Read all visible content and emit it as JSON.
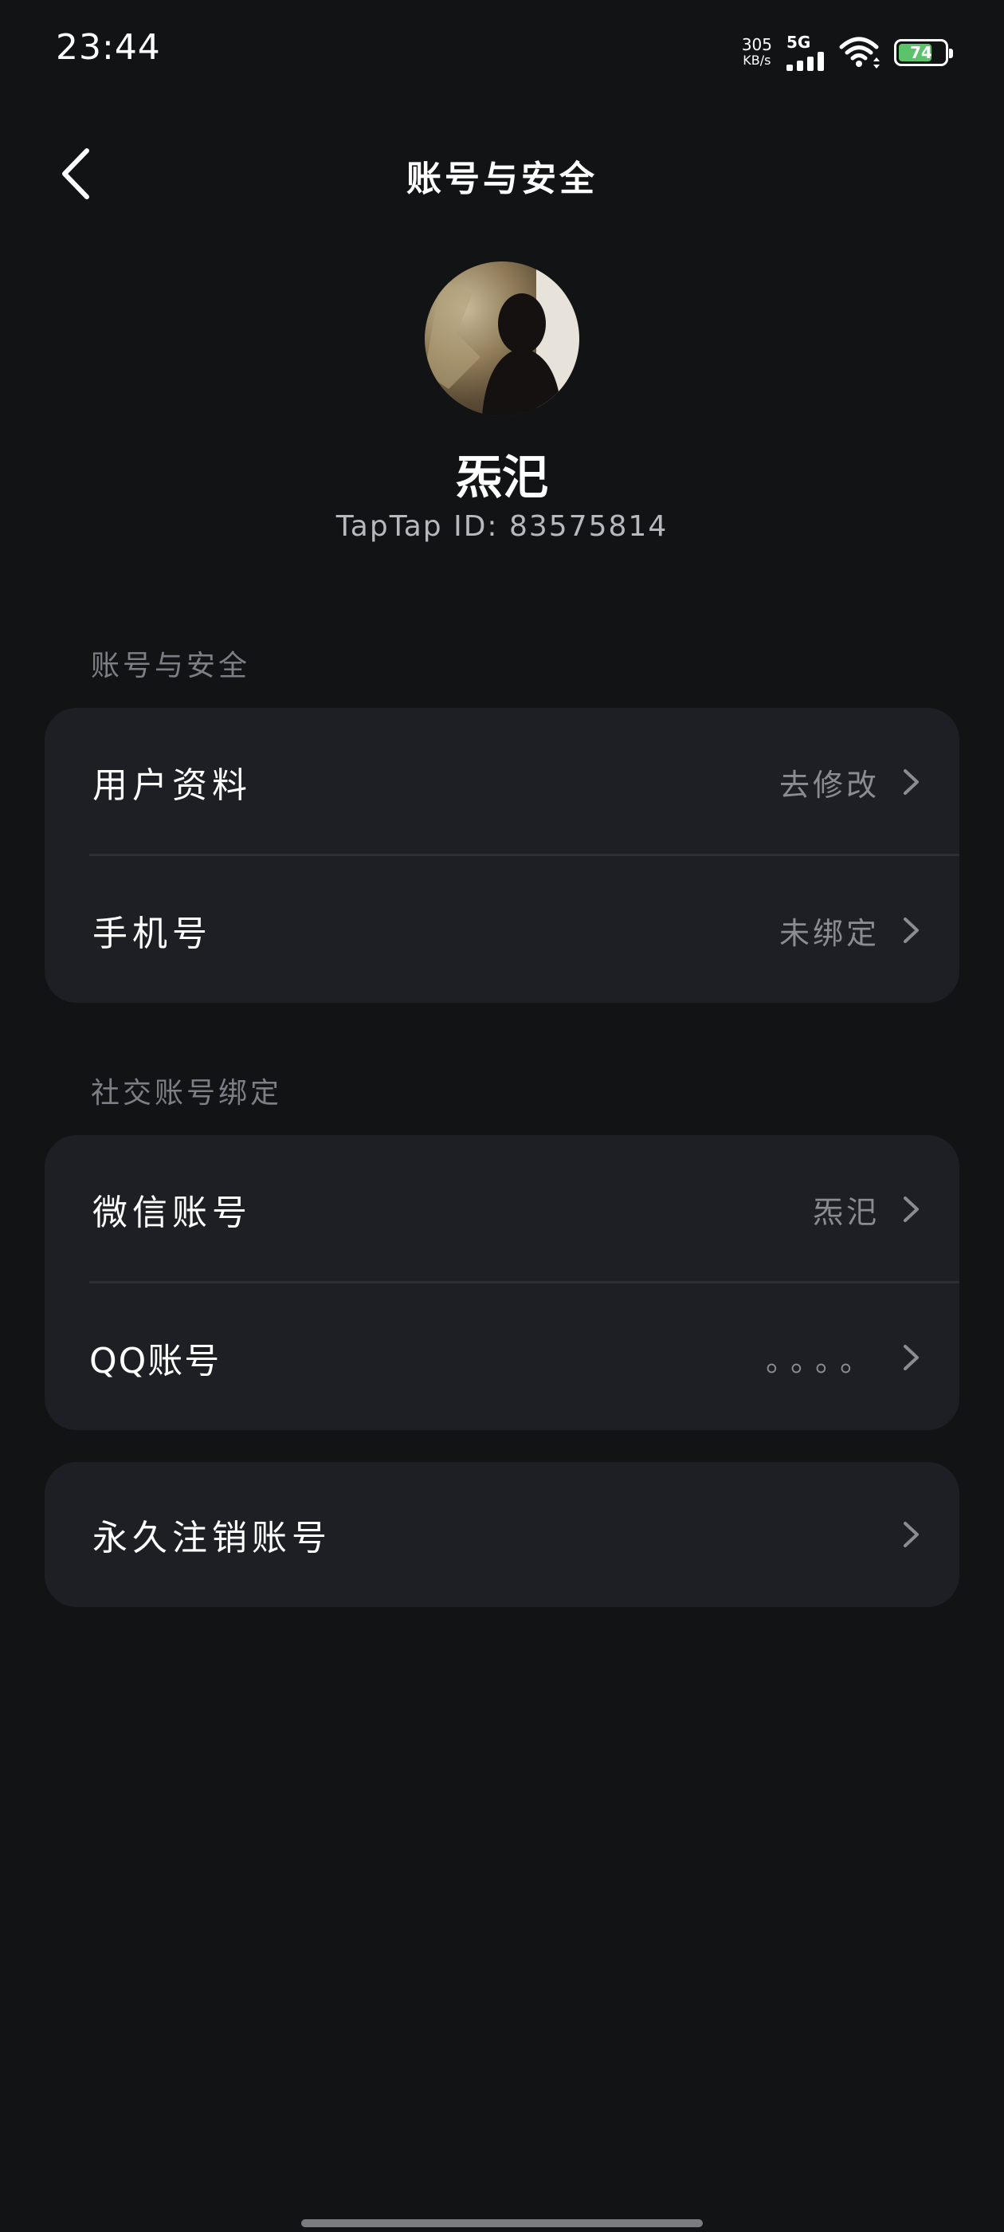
{
  "status_bar": {
    "time": "23:44",
    "net_speed_value": "305",
    "net_speed_unit": "KB/s",
    "network_type": "5G",
    "battery_level": "74",
    "battery_color": "#5cc36c"
  },
  "nav": {
    "title": "账号与安全",
    "back_icon": "chevron-left-icon"
  },
  "profile": {
    "name": "炁汜",
    "taptap_id": "TapTap ID: 83575814"
  },
  "sections": {
    "account_security": {
      "title": "账号与安全",
      "rows": [
        {
          "label": "用户资料",
          "value": "去修改"
        },
        {
          "label": "手机号",
          "value": "未绑定"
        }
      ]
    },
    "social_binding": {
      "title": "社交账号绑定",
      "rows": [
        {
          "label": "微信账号",
          "value": "炁汜"
        },
        {
          "label": "QQ账号",
          "value": "。。。。"
        }
      ]
    },
    "danger": {
      "rows": [
        {
          "label": "永久注销账号",
          "value": ""
        }
      ]
    }
  },
  "colors": {
    "background": "#121314",
    "card": "#1e1f24",
    "secondary_text": "#8a8c92"
  }
}
